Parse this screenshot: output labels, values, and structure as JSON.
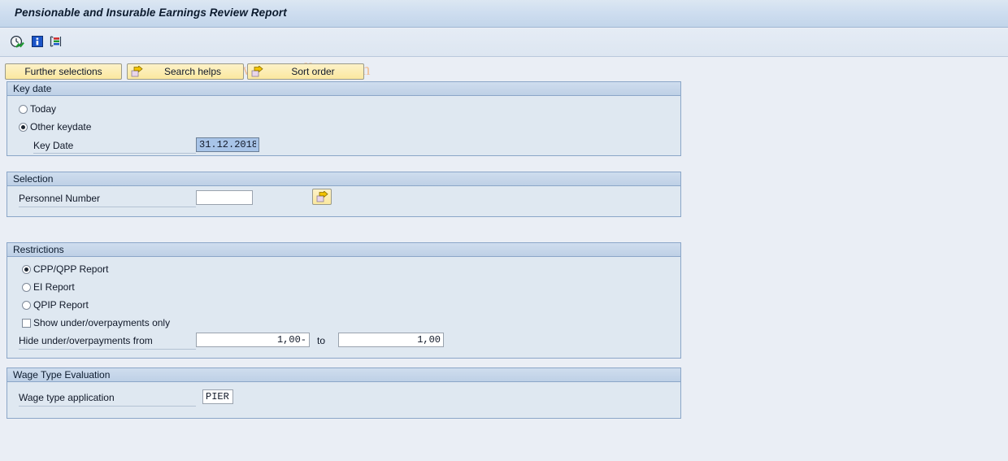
{
  "window": {
    "title": "Pensionable and Insurable Earnings Review Report"
  },
  "watermark": {
    "text": "© www.tutorialkart.com"
  },
  "toolbar": {
    "icons": [
      {
        "name": "execute-clock-icon",
        "tooltip": "Execute"
      },
      {
        "name": "info-icon",
        "tooltip": "Information"
      },
      {
        "name": "variant-icon",
        "tooltip": "Get Variant"
      }
    ]
  },
  "buttons": {
    "further_selections": "Further selections",
    "search_helps": "Search helps",
    "sort_order": "Sort order"
  },
  "sections": {
    "key_date": {
      "header": "Key date",
      "radio_today": "Today",
      "radio_other": "Other keydate",
      "selected": "other",
      "key_date_label": "Key Date",
      "key_date_value": "31.12.2018"
    },
    "selection": {
      "header": "Selection",
      "personnel_number_label": "Personnel Number",
      "personnel_number_value": "",
      "multi_select_tooltip": "Multiple selection"
    },
    "restrictions": {
      "header": "Restrictions",
      "radio_cpp": "CPP/QPP Report",
      "radio_ei": "EI Report",
      "radio_qpip": "QPIP Report",
      "selected_report": "cpp",
      "checkbox_show_only": "Show under/overpayments only",
      "checkbox_checked": false,
      "hide_label": "Hide under/overpayments from",
      "hide_from_value": "1,00-",
      "hide_to_word": "to",
      "hide_to_value": "1,00"
    },
    "wage_type": {
      "header": "Wage Type Evaluation",
      "application_label": "Wage type application",
      "application_value": "PIER"
    }
  },
  "colors": {
    "page_background": "#eaeef5",
    "group_background": "#dfe8f1",
    "group_border": "#8ba6c8",
    "group_header": "#c6d6e9",
    "button_yellow": "#fbe89f",
    "field_selected": "#a8c4e8",
    "watermark": "#f0c098"
  }
}
